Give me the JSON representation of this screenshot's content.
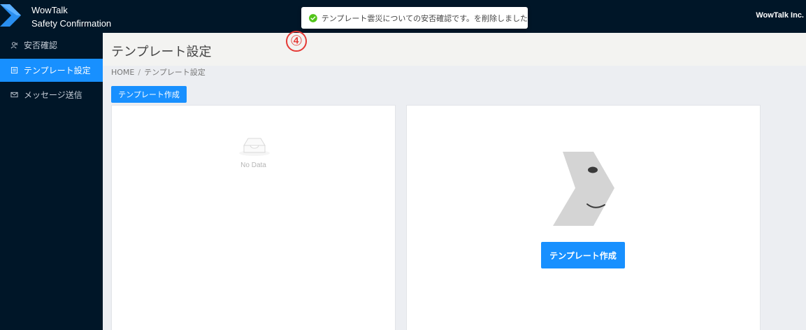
{
  "header": {
    "brand_line1": "WowTalk",
    "brand_line2": "Safety Confirmation",
    "company": "WowTalk Inc.",
    "logo_icon": "chevron-logo-icon"
  },
  "toast": {
    "icon": "check-circle-icon",
    "message": "テンプレート雲災についての安否確認です。を削除しました"
  },
  "sidebar": {
    "items": [
      {
        "label": "安否確認",
        "icon": "people-icon",
        "active": false
      },
      {
        "label": "テンプレート設定",
        "icon": "template-icon",
        "active": true
      },
      {
        "label": "メッセージ送信",
        "icon": "mail-icon",
        "active": false
      }
    ]
  },
  "page": {
    "title": "テンプレート設定",
    "step_marker": "④"
  },
  "breadcrumb": {
    "home": "HOME",
    "separator": "/",
    "current": "テンプレート設定"
  },
  "toolbar": {
    "create_label": "テンプレート作成"
  },
  "list_panel": {
    "empty_icon": "inbox-icon",
    "empty_text": "No Data"
  },
  "detail_panel": {
    "mascot": "wowtalk-mascot-icon",
    "create_label": "テンプレート作成"
  },
  "colors": {
    "header_bg": "#001628",
    "accent": "#1890ff",
    "marker": "#e53935",
    "success": "#52c41a"
  }
}
